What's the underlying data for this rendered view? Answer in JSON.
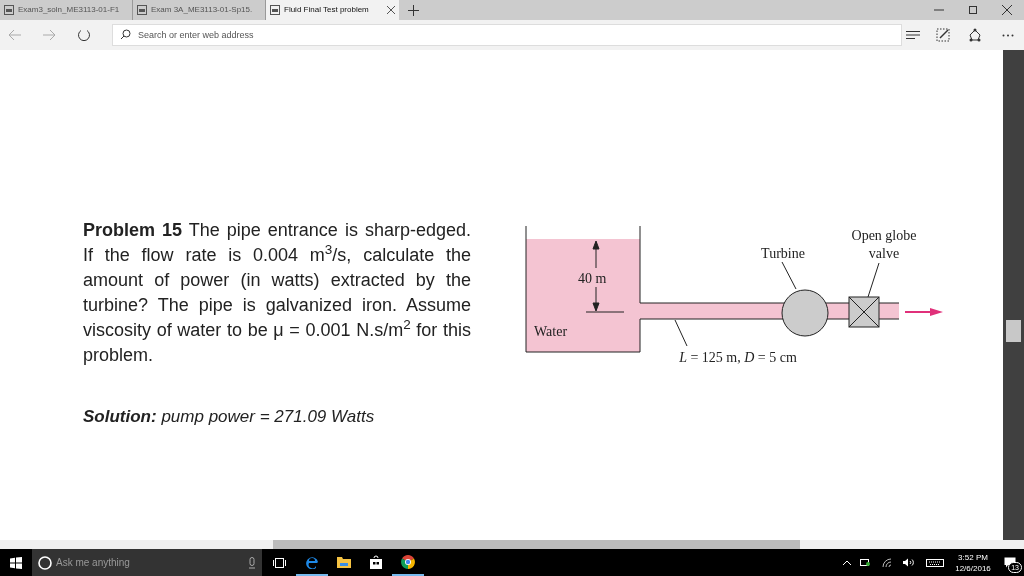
{
  "tabs": [
    {
      "label": "Exam3_soln_ME3113-01-F1",
      "selected": false
    },
    {
      "label": "Exam 3A_ME3113-01-Sp15.",
      "selected": false
    },
    {
      "label": "Fluid Final Test problem",
      "selected": true
    }
  ],
  "address_bar": {
    "placeholder": "Search or enter web address"
  },
  "document": {
    "problem": "**Problem 15** The pipe entrance is sharp-edged. If the flow rate is 0.004 m$^{3}$/s, calculate the amount of power (in watts) extracted by the turbine? The pipe is galvanized iron. Assume viscosity of water to be μ = 0.001 N.s/m$^{2}$ for this problem.",
    "solution": "**Solution:** pump power = 271.09 Watts",
    "diagram": {
      "height_label": "40 m",
      "tank_label": "Water",
      "turbine_label": "Turbine",
      "valve_label": [
        "Open globe",
        "valve"
      ],
      "pipe_label": "*L* = 125 m, *D* = 5 cm"
    }
  },
  "taskbar": {
    "search_placeholder": "Ask me anything",
    "apps": [
      {
        "kind": "edge",
        "open": true
      },
      {
        "kind": "explorer",
        "open": false
      },
      {
        "kind": "store",
        "open": false
      },
      {
        "kind": "chrome",
        "open": true
      }
    ],
    "time": "3:52 PM",
    "date": "12/6/2016",
    "notifications": "13"
  }
}
